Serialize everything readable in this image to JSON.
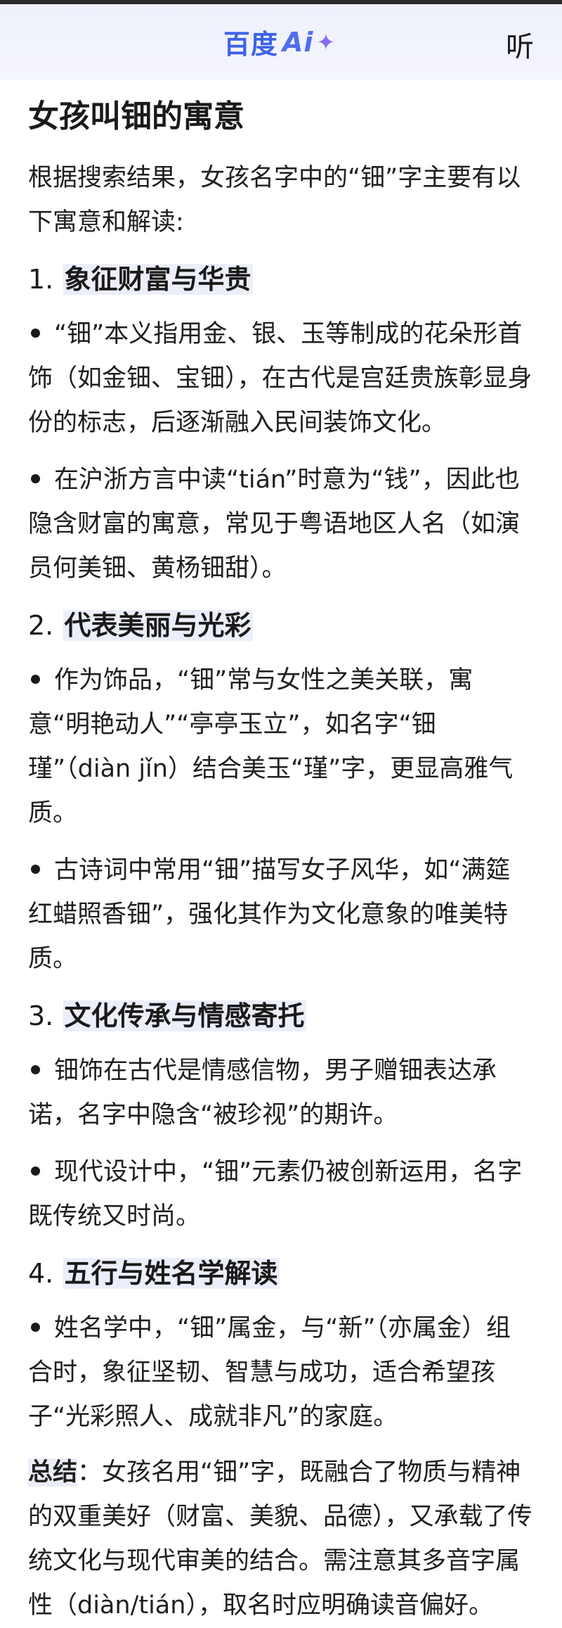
{
  "header": {
    "logo_cn": "百度",
    "logo_ai": "Ai",
    "logo_plus": "✦",
    "listen_label": "听"
  },
  "article": {
    "title": "女孩叫钿的寓意",
    "intro": "根据搜索结果，女孩名字中的“钿”字主要有以下寓意和解读:",
    "sections": [
      {
        "num": "1.",
        "title": "象征财富与华贵",
        "bullets": [
          "“钿”本义指用金、银、玉等制成的花朵形首饰（如金钿、宝钿），在古代是宫廷贵族彰显身份的标志，后逐渐融入民间装饰文化。",
          "在沪浙方言中读“tián”时意为“钱”，因此也隐含财富的寓意，常见于粤语地区人名（如演员何美钿、黄杨钿甜）。"
        ]
      },
      {
        "num": "2.",
        "title": "代表美丽与光彩",
        "bullets": [
          "作为饰品，“钿”常与女性之美关联，寓意“明艳动人”“亭亭玉立”，如名字“钿瑾”（diàn jǐn）结合美玉“瑾”字，更显高雅气质。",
          "古诗词中常用“钿”描写女子风华，如“满筵红蜡照香钿”，强化其作为文化意象的唯美特质。"
        ]
      },
      {
        "num": "3.",
        "title": "文化传承与情感寄托",
        "bullets": [
          "钿饰在古代是情感信物，男子赠钿表达承诺，名字中隐含“被珍视”的期许。",
          "现代设计中，“钿”元素仍被创新运用，名字既传统又时尚。"
        ]
      },
      {
        "num": "4.",
        "title": "五行与姓名学解读",
        "bullets": [
          "姓名学中，“钿”属金，与“新”（亦属金）组合时，象征坚韧、智慧与成功，适合希望孩子“光彩照人、成就非凡”的家庭。"
        ]
      }
    ],
    "summary_label": "总结",
    "summary_text": "：女孩名用“钿”字，既融合了物质与精神的双重美好（财富、美貌、品德），又承载了传统文化与现代审美的结合。需注意其多音字属性（diàn/tián），取名时应明确读音偏好。"
  }
}
